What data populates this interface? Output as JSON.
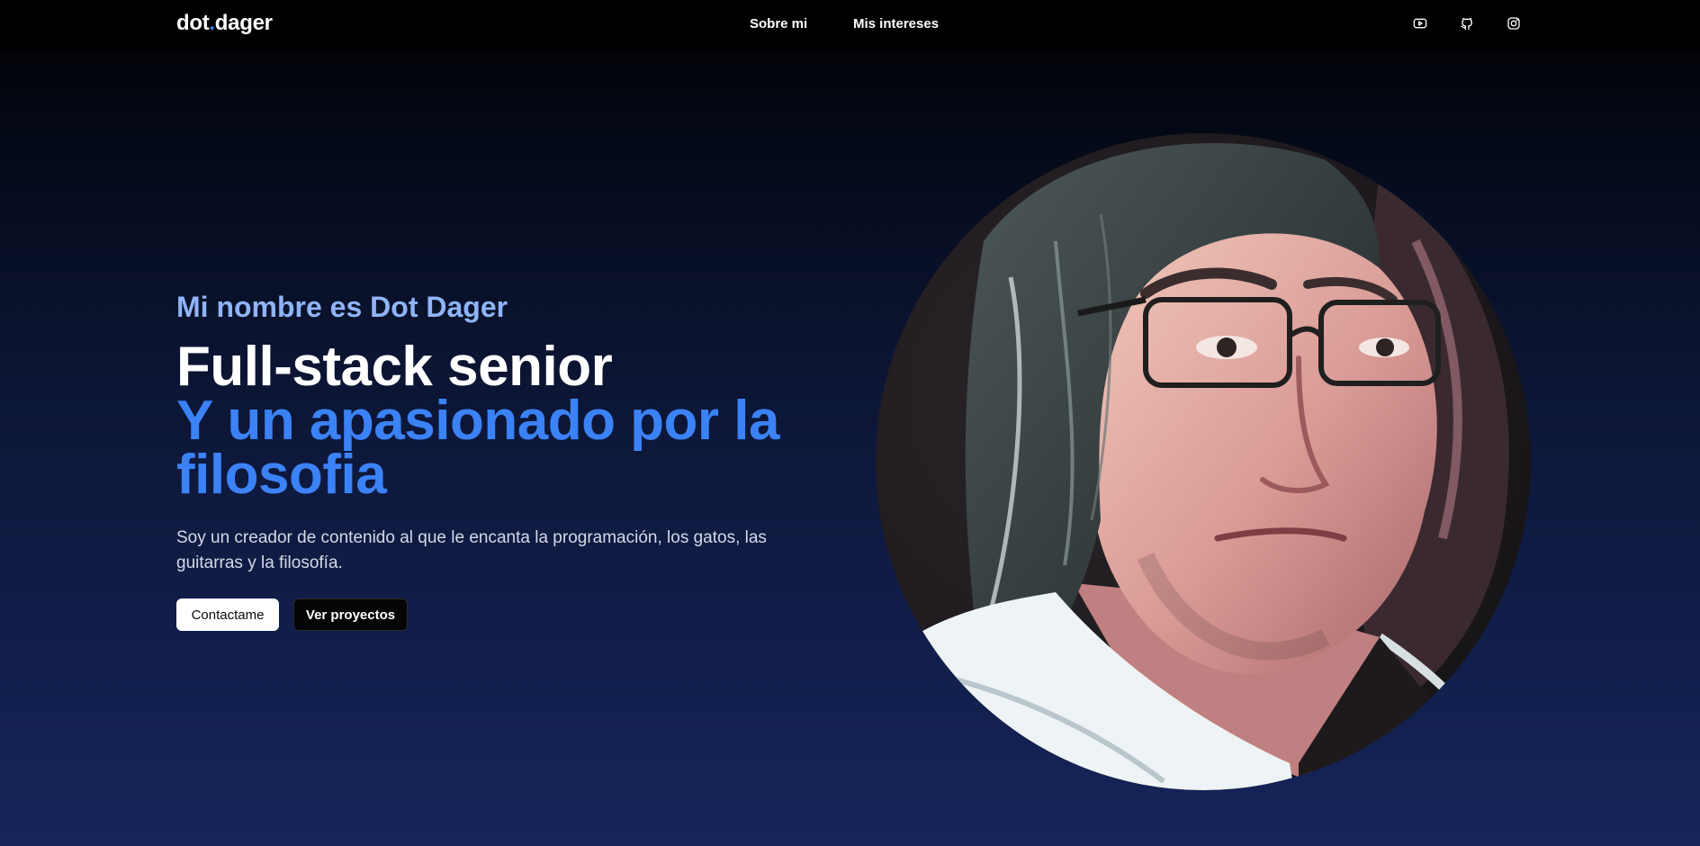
{
  "nav": {
    "logo_main": "dot",
    "logo_dot": ".",
    "logo_rest": "dager",
    "links": [
      {
        "label": "Sobre mi"
      },
      {
        "label": "Mis intereses"
      }
    ],
    "social_icons": [
      "youtube-icon",
      "github-icon",
      "instagram-icon"
    ]
  },
  "hero": {
    "eyebrow": "Mi nombre es Dot Dager",
    "headline_line1": "Full-stack senior",
    "headline_line2": "Y un apasionado por la filosofia",
    "description": "Soy un creador de contenido al que le encanta la programación, los gatos, las guitarras y la filosofía.",
    "primary_button": "Contactame",
    "secondary_button": "Ver proyectos"
  },
  "colors": {
    "accent": "#3b82f6",
    "eyebrow": "#8fb4f8",
    "background_top": "#000000",
    "background_bottom": "#15245a"
  }
}
